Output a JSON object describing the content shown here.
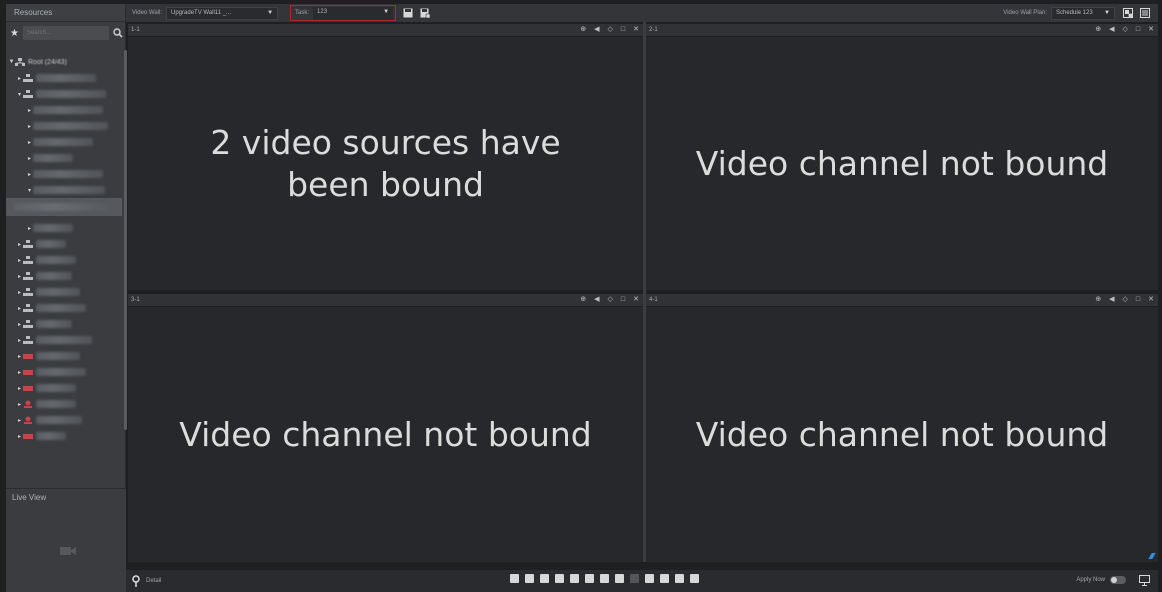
{
  "sidebar": {
    "title": "Resources",
    "search_placeholder": "Search...",
    "root_label": "Root (24/43)",
    "live_view_label": "Live View"
  },
  "toolbar": {
    "video_wall_label": "Video Wall:",
    "video_wall_value": "UpgradeTV Wall11 _...",
    "task_label": "Task:",
    "task_value": "123",
    "plan_label": "Video Wall Plan:",
    "plan_value": "Schedule 123"
  },
  "panes": [
    {
      "label": "1-1",
      "message": "2 video sources have been bound"
    },
    {
      "label": "2-1",
      "message": "Video channel not bound"
    },
    {
      "label": "3-1",
      "message": "Video channel not bound"
    },
    {
      "label": "4-1",
      "message": "Video channel not bound"
    }
  ],
  "bottom": {
    "detail_label": "Detail",
    "apply_now_label": "Apply Now"
  },
  "colors": {
    "task_border": "#b8232b",
    "background": "#1e1f21",
    "pane": "#27282b"
  },
  "icons": {
    "pane_header": [
      "target-icon",
      "audio-icon",
      "ptz-icon",
      "maximize-icon",
      "close-icon"
    ]
  }
}
